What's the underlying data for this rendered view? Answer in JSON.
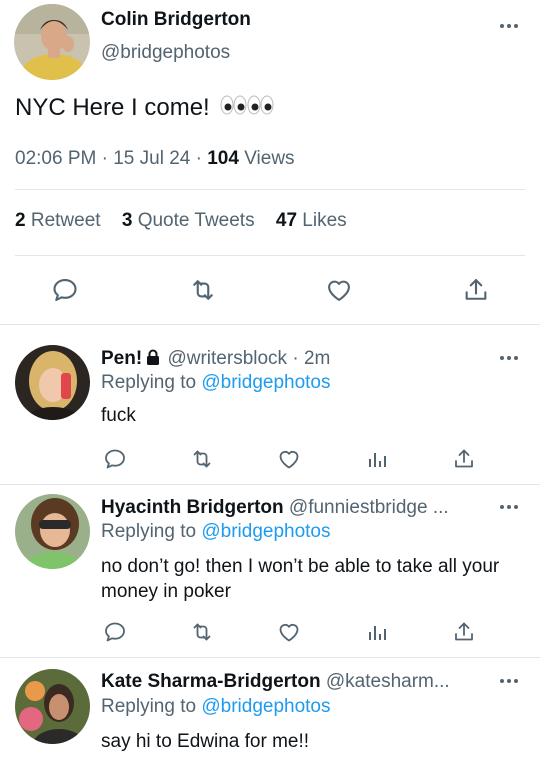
{
  "main_tweet": {
    "author_name": "Colin Bridgerton",
    "author_handle": "@bridgephotos",
    "text": "NYC Here I come! ",
    "emoji": "👀👀",
    "time": "02:06 PM · 15 Jul 24 · ",
    "views_count": "104",
    "views_label": " Views",
    "retweets_count": "2",
    "retweets_label": "Retweet",
    "quotes_count": "3",
    "quotes_label": "Quote Tweets",
    "likes_count": "47",
    "likes_label": "Likes"
  },
  "replies": [
    {
      "name": "Pen!",
      "handle": "@writersblock",
      "time_suffix": " · 2m",
      "replying_label": "Replying to ",
      "replying_to": "@bridgephotos",
      "text": "fuck"
    },
    {
      "name": "Hyacinth Bridgerton",
      "handle": "@funniestbridge ...",
      "replying_label": "Replying to ",
      "replying_to": "@bridgephotos",
      "text": "no don’t go! then I won’t be able to take all your money in poker"
    },
    {
      "name": "Kate Sharma-Bridgerton",
      "handle": "@katesharm...",
      "replying_label": "Replying to ",
      "replying_to": "@bridgephotos",
      "text": "say hi to Edwina for me!!"
    }
  ],
  "icons": [
    "reply-icon",
    "retweet-icon",
    "like-icon",
    "share-icon",
    "analytics-icon",
    "more-icon",
    "lock-icon"
  ],
  "colors": {
    "link": "#1d9bf0",
    "secondary": "#536471",
    "primary": "#0f1419",
    "divider": "#e1e6ea"
  }
}
